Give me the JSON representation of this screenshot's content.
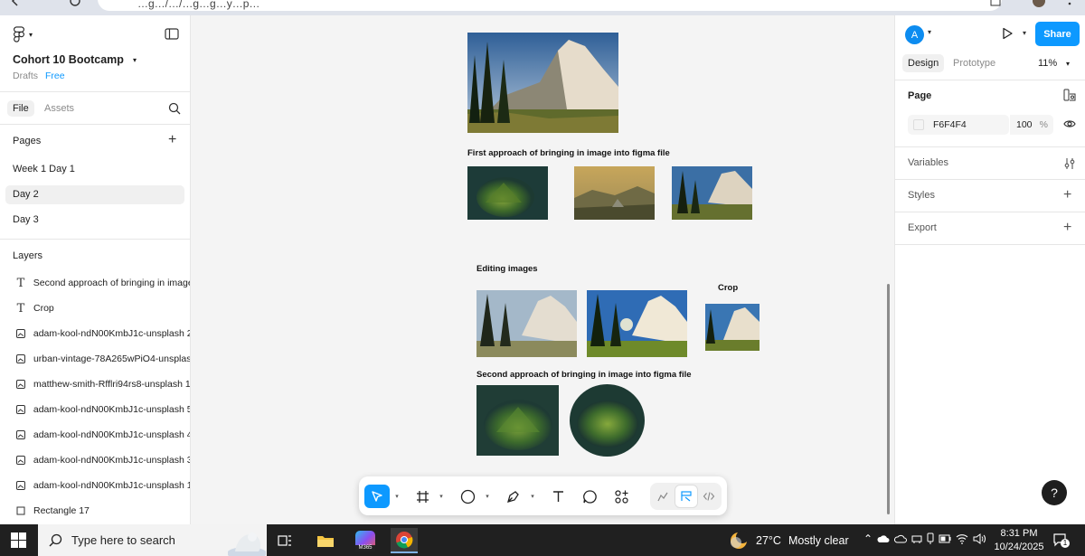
{
  "browser": {
    "address_fragment": "…g…/…/…g…g…y…p…"
  },
  "left_panel": {
    "file_name": "Cohort 10 Bootcamp",
    "location": "Drafts",
    "plan": "Free",
    "tabs": {
      "file": "File",
      "assets": "Assets"
    },
    "pages_title": "Pages",
    "pages": [
      {
        "label": "Week 1 Day 1",
        "selected": false
      },
      {
        "label": "Day 2",
        "selected": true
      },
      {
        "label": "Day 3",
        "selected": false
      }
    ],
    "layers_title": "Layers",
    "layers": [
      {
        "label": "Second approach of bringing in image",
        "icon": "text-icon"
      },
      {
        "label": "Crop",
        "icon": "text-icon"
      },
      {
        "label": "adam-kool-ndN00KmbJ1c-unsplash 2",
        "icon": "image-icon"
      },
      {
        "label": "urban-vintage-78A265wPiO4-unsplas",
        "icon": "image-icon"
      },
      {
        "label": "matthew-smith-Rfflri94rs8-unsplash 1",
        "icon": "image-icon"
      },
      {
        "label": "adam-kool-ndN00KmbJ1c-unsplash 5",
        "icon": "image-icon"
      },
      {
        "label": "adam-kool-ndN00KmbJ1c-unsplash 4",
        "icon": "image-icon"
      },
      {
        "label": "adam-kool-ndN00KmbJ1c-unsplash 3",
        "icon": "image-icon"
      },
      {
        "label": "adam-kool-ndN00KmbJ1c-unsplash 1",
        "icon": "image-icon"
      },
      {
        "label": "Rectangle 17",
        "icon": "rectangle-icon"
      }
    ]
  },
  "canvas": {
    "heading_first": "First approach of bringing in image into figma file",
    "heading_editing": "Editing  images",
    "heading_crop": "Crop",
    "heading_second": "Second approach of bringing in image into figma file"
  },
  "right_panel": {
    "avatar_letter": "A",
    "share_label": "Share",
    "tabs": {
      "design": "Design",
      "prototype": "Prototype"
    },
    "zoom": "11%",
    "page_section": "Page",
    "bg_color": "F6F4F4",
    "bg_opacity": "100",
    "opacity_unit": "%",
    "variables": "Variables",
    "styles": "Styles",
    "export": "Export",
    "help": "?"
  },
  "taskbar": {
    "search_placeholder": "Type here to search",
    "weather_temp": "27°C",
    "weather_desc": "Mostly clear",
    "time": "8:31 PM",
    "date": "10/24/2025",
    "notification_count": "1",
    "m365_label": "M365"
  },
  "colors": {
    "accent": "#0d99ff",
    "canvas_bg": "#f4f4f4",
    "taskbar_bg": "#202020"
  }
}
